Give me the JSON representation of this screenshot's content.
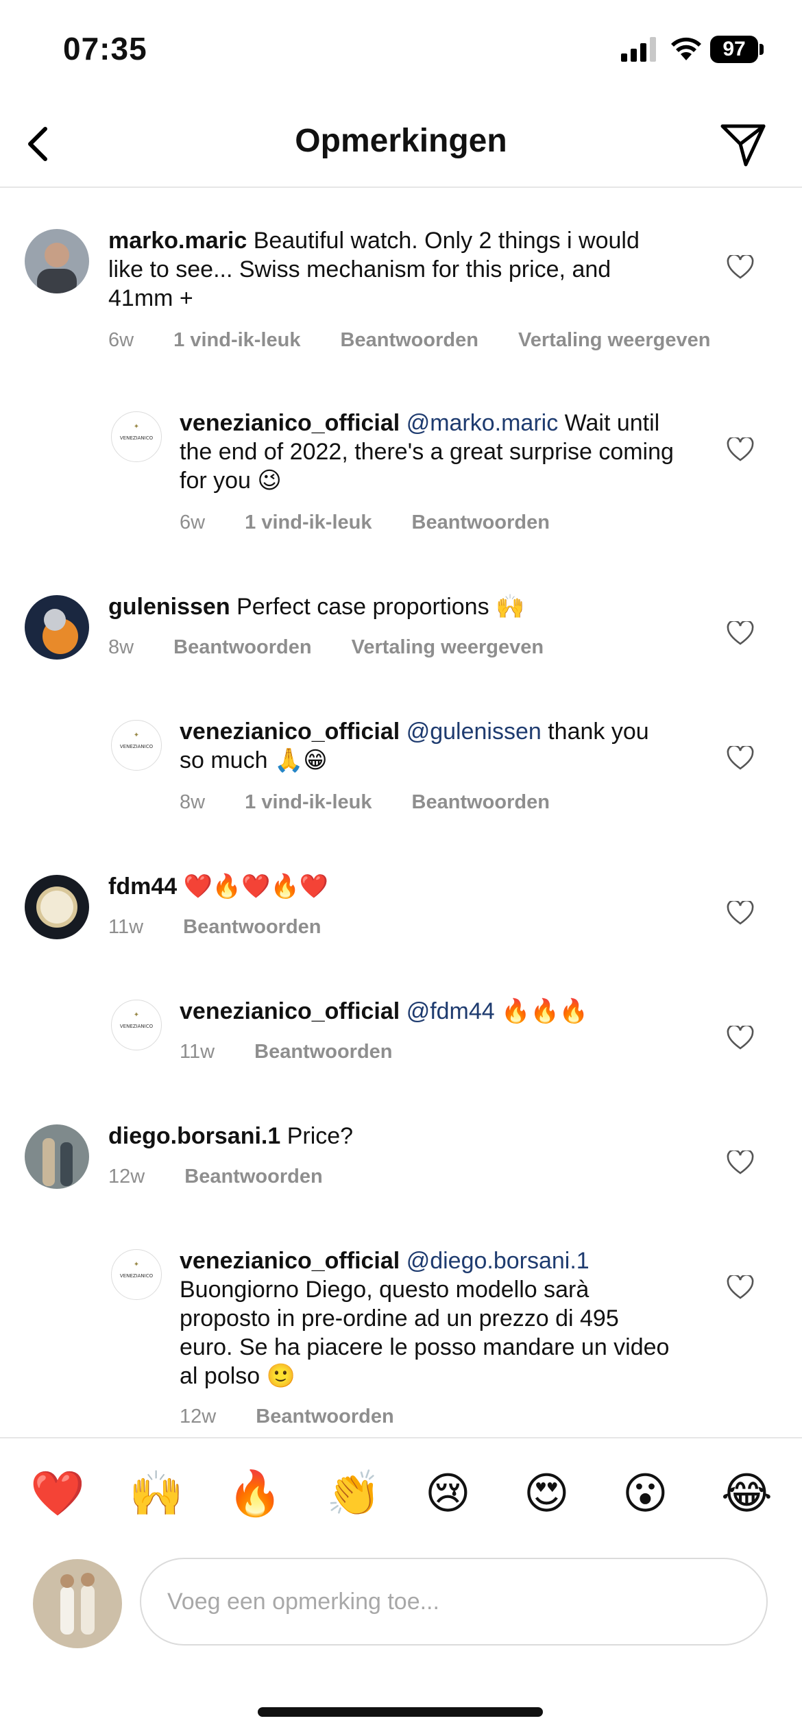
{
  "status_bar": {
    "time": "07:35",
    "battery": "97"
  },
  "header": {
    "title": "Opmerkingen"
  },
  "comments": [
    {
      "user": "marko.maric",
      "mention": "",
      "text": "Beautiful watch. Only 2 things i would like to see... Swiss mechanism for this price, and 41mm +",
      "age": "6w",
      "likes": "1 vind-ik-leuk",
      "reply": "Beantwoorden",
      "translate": "Vertaling weergeven"
    },
    {
      "user": "venezianico_official",
      "mention": "@marko.maric",
      "text": "Wait until the end of 2022, there's a great surprise coming for you 😉",
      "age": "6w",
      "likes": "1 vind-ik-leuk",
      "reply": "Beantwoorden",
      "translate": ""
    },
    {
      "user": "gulenissen",
      "mention": "",
      "text": "Perfect case proportions 🙌",
      "age": "8w",
      "likes": "",
      "reply": "Beantwoorden",
      "translate": "Vertaling weergeven"
    },
    {
      "user": "venezianico_official",
      "mention": "@gulenissen",
      "text": "thank you so much 🙏😁",
      "age": "8w",
      "likes": "1 vind-ik-leuk",
      "reply": "Beantwoorden",
      "translate": ""
    },
    {
      "user": "fdm44",
      "mention": "",
      "text": "❤️🔥❤️🔥❤️",
      "age": "11w",
      "likes": "",
      "reply": "Beantwoorden",
      "translate": ""
    },
    {
      "user": "venezianico_official",
      "mention": "@fdm44",
      "text": "🔥🔥🔥",
      "age": "11w",
      "likes": "",
      "reply": "Beantwoorden",
      "translate": ""
    },
    {
      "user": "diego.borsani.1",
      "mention": "",
      "text": "Price?",
      "age": "12w",
      "likes": "",
      "reply": "Beantwoorden",
      "translate": ""
    },
    {
      "user": "venezianico_official",
      "mention": "@diego.borsani.1",
      "text": "Buongiorno Diego, questo modello sarà proposto in pre-ordine ad un prezzo di 495 euro. Se ha piacere le posso mandare un video al polso 🙂",
      "age": "12w",
      "likes": "",
      "reply": "Beantwoorden",
      "translate": ""
    }
  ],
  "quick_emojis": [
    "❤️",
    "🙌",
    "🔥",
    "👏",
    "😢",
    "😍",
    "😮",
    "😂"
  ],
  "composer": {
    "placeholder": "Voeg een opmerking toe..."
  },
  "logo_text": "VENEZIANICO",
  "colors": {
    "mention": "#1e3b6f",
    "meta": "#8e8e8e",
    "divider": "#e6e6e6"
  }
}
